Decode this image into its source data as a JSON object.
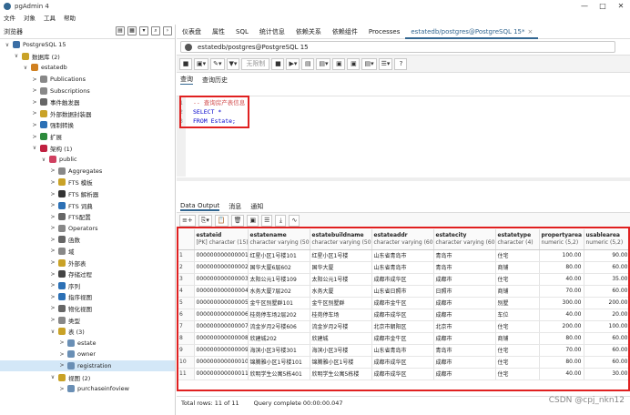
{
  "window": {
    "title": "pgAdmin 4",
    "controls": [
      "—",
      "□",
      "✕"
    ]
  },
  "menu": [
    "文件",
    "对象",
    "工具",
    "帮助"
  ],
  "browser": {
    "title": "浏览器",
    "toolbar_icons": [
      "database-icon",
      "table-icon",
      "filter-icon",
      "search-icon",
      "terminal-icon"
    ],
    "tree": [
      {
        "label": "PostgreSQL 15",
        "indent": 0,
        "chev": "∨",
        "icon": "server-icon",
        "color": "#3b6ea5"
      },
      {
        "label": "数据库 (2)",
        "indent": 1,
        "chev": "∨",
        "icon": "databases-icon",
        "color": "#c9a227"
      },
      {
        "label": "estatedb",
        "indent": 2,
        "chev": "∨",
        "icon": "database-icon",
        "color": "#d08020"
      },
      {
        "label": "Publications",
        "indent": 3,
        "chev": ">",
        "icon": "publication-icon",
        "color": "#888"
      },
      {
        "label": "Subscriptions",
        "indent": 3,
        "chev": ">",
        "icon": "subscription-icon",
        "color": "#888"
      },
      {
        "label": "事件触发器",
        "indent": 3,
        "chev": ">",
        "icon": "event-trigger-icon",
        "color": "#666"
      },
      {
        "label": "外部数据封装器",
        "indent": 3,
        "chev": ">",
        "icon": "fdw-icon",
        "color": "#c9a227"
      },
      {
        "label": "强制转换",
        "indent": 3,
        "chev": ">",
        "icon": "cast-icon",
        "color": "#2c70b5"
      },
      {
        "label": "扩展",
        "indent": 3,
        "chev": ">",
        "icon": "extension-icon",
        "color": "#2c8a3b"
      },
      {
        "label": "架构 (1)",
        "indent": 3,
        "chev": "∨",
        "icon": "schemas-icon",
        "color": "#c02040"
      },
      {
        "label": "public",
        "indent": 4,
        "chev": "∨",
        "icon": "schema-icon",
        "color": "#d04060"
      },
      {
        "label": "Aggregates",
        "indent": 5,
        "chev": ">",
        "icon": "aggregate-icon",
        "color": "#888"
      },
      {
        "label": "FTS 模板",
        "indent": 5,
        "chev": ">",
        "icon": "fts-template-icon",
        "color": "#c9a227"
      },
      {
        "label": "FTS 解析器",
        "indent": 5,
        "chev": ">",
        "icon": "fts-parser-icon",
        "color": "#333"
      },
      {
        "label": "FTS 词典",
        "indent": 5,
        "chev": ">",
        "icon": "fts-dictionary-icon",
        "color": "#2c70b5"
      },
      {
        "label": "FTS配置",
        "indent": 5,
        "chev": ">",
        "icon": "fts-config-icon",
        "color": "#666"
      },
      {
        "label": "Operators",
        "indent": 5,
        "chev": ">",
        "icon": "operator-icon",
        "color": "#888"
      },
      {
        "label": "函数",
        "indent": 5,
        "chev": ">",
        "icon": "function-icon",
        "color": "#666"
      },
      {
        "label": "域",
        "indent": 5,
        "chev": ">",
        "icon": "domain-icon",
        "color": "#888"
      },
      {
        "label": "外部表",
        "indent": 5,
        "chev": ">",
        "icon": "foreign-table-icon",
        "color": "#c9a227"
      },
      {
        "label": "存储过程",
        "indent": 5,
        "chev": ">",
        "icon": "procedure-icon",
        "color": "#444"
      },
      {
        "label": "序列",
        "indent": 5,
        "chev": ">",
        "icon": "sequence-icon",
        "color": "#2c70b5"
      },
      {
        "label": "指序视图",
        "indent": 5,
        "chev": ">",
        "icon": "mview-icon",
        "color": "#2c70b5"
      },
      {
        "label": "物化视图",
        "indent": 5,
        "chev": ">",
        "icon": "materialized-view-icon",
        "color": "#666"
      },
      {
        "label": "类型",
        "indent": 5,
        "chev": ">",
        "icon": "type-icon",
        "color": "#888"
      },
      {
        "label": "表 (3)",
        "indent": 5,
        "chev": "∨",
        "icon": "tables-icon",
        "color": "#c9a227"
      },
      {
        "label": "estate",
        "indent": 6,
        "chev": ">",
        "icon": "table-icon",
        "color": "#6a8fb5"
      },
      {
        "label": "owner",
        "indent": 6,
        "chev": ">",
        "icon": "table-icon",
        "color": "#6a8fb5"
      },
      {
        "label": "registration",
        "indent": 6,
        "chev": ">",
        "icon": "table-icon",
        "color": "#6a8fb5",
        "selected": true
      },
      {
        "label": "视图 (2)",
        "indent": 5,
        "chev": "∨",
        "icon": "views-icon",
        "color": "#c9a227"
      },
      {
        "label": "purchaseinfoview",
        "indent": 6,
        "chev": ">",
        "icon": "view-icon",
        "color": "#6a8fb5"
      }
    ]
  },
  "tabs": [
    {
      "label": "仪表盘"
    },
    {
      "label": "属性"
    },
    {
      "label": "SQL"
    },
    {
      "label": "统计信息"
    },
    {
      "label": "依赖关系"
    },
    {
      "label": "依赖组件"
    },
    {
      "label": "Processes"
    },
    {
      "label": "estatedb/postgres@PostgreSQL 15*",
      "active": true,
      "closable": true
    }
  ],
  "connection": "estatedb/postgres@PostgreSQL 15",
  "toolbar": {
    "limit_label": "无限制"
  },
  "query_tabs": [
    "查询",
    "查询历史"
  ],
  "editor": {
    "lines": [
      {
        "num": "1",
        "text": "-- 查询房产表信息",
        "type": "comment"
      },
      {
        "num": "2",
        "text": "SELECT *",
        "type": "code"
      },
      {
        "num": "3",
        "text": "FROM Estate;",
        "type": "code"
      }
    ]
  },
  "output_tabs": [
    "Data Output",
    "消息",
    "通知"
  ],
  "grid": {
    "columns": [
      {
        "name": "estateid",
        "type": "[PK] character (15)"
      },
      {
        "name": "estatename",
        "type": "character varying (50)"
      },
      {
        "name": "estatebuildname",
        "type": "character varying (50)"
      },
      {
        "name": "estateaddr",
        "type": "character varying (60)"
      },
      {
        "name": "estatecity",
        "type": "character varying (60)"
      },
      {
        "name": "estatetype",
        "type": "character (4)"
      },
      {
        "name": "propertyarea",
        "type": "numeric (5,2)"
      },
      {
        "name": "usablearea",
        "type": "numeric (5,2)"
      }
    ],
    "rows": [
      [
        "1",
        "000000000000001",
        "红星小区1号楼101",
        "红星小区1号楼",
        "山东省青岛市",
        "青岛市",
        "住宅",
        "100.00",
        "90.00"
      ],
      [
        "2",
        "000000000000002",
        "国华大厦6层602",
        "国华大厦",
        "山东省青岛市",
        "青岛市",
        "商铺",
        "80.00",
        "60.00"
      ],
      [
        "3",
        "000000000000003",
        "太阳公元1号楼109",
        "太阳公元1号楼",
        "成都市成华区",
        "成都市",
        "住宅",
        "40.00",
        "35.00"
      ],
      [
        "4",
        "000000000000004",
        "水务大厦7层202",
        "水务大厦",
        "山东省日照市",
        "日照市",
        "商铺",
        "70.00",
        "60.00"
      ],
      [
        "5",
        "000000000000005",
        "金牛区别墅群101",
        "金牛区别墅群",
        "成都市金牛区",
        "成都市",
        "别墅",
        "300.00",
        "200.00"
      ],
      [
        "6",
        "000000000000006",
        "桂苑停车场2层202",
        "桂苑停车场",
        "成都市成华区",
        "成都市",
        "车位",
        "40.00",
        "20.00"
      ],
      [
        "7",
        "000000000000007",
        "流金岁月2号楼606",
        "流金岁月2号楼",
        "北京市朝阳区",
        "北京市",
        "住宅",
        "200.00",
        "100.00"
      ],
      [
        "8",
        "000000000000008",
        "欣建城202",
        "欣建城",
        "成都市金牛区",
        "成都市",
        "商铺",
        "80.00",
        "60.00"
      ],
      [
        "9",
        "000000000000009",
        "海滨小区3号楼301",
        "海滨小区3号楼",
        "山东省青岛市",
        "青岛市",
        "住宅",
        "70.00",
        "60.00"
      ],
      [
        "10",
        "000000000000010",
        "锦腾雅小区1号楼101",
        "锦腾雅小区1号楼",
        "成都市成华区",
        "成都市",
        "住宅",
        "80.00",
        "60.00"
      ],
      [
        "11",
        "000000000000011",
        "欣明学生公寓5栋401",
        "欣明学生公寓5栋楼",
        "成都市成华区",
        "成都市",
        "住宅",
        "40.00",
        "30.00"
      ]
    ]
  },
  "status": {
    "rows": "Total rows: 11 of 11",
    "query": "Query complete 00:00:00.047"
  },
  "watermark": "CSDN @cpj_nkn12",
  "colors": {
    "accent": "#326690",
    "highlight": "#e02020",
    "selection": "#d3e7f7"
  }
}
